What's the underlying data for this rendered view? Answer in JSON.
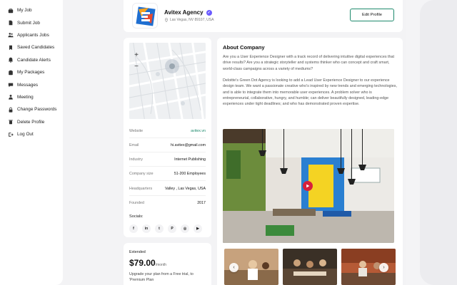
{
  "sidebar": {
    "items": [
      {
        "label": "My Job",
        "icon": "briefcase-icon"
      },
      {
        "label": "Submit Job",
        "icon": "document-icon"
      },
      {
        "label": "Applicants Jobs",
        "icon": "users-icon"
      },
      {
        "label": "Saved Candidates",
        "icon": "bookmark-icon"
      },
      {
        "label": "Candidate Alerts",
        "icon": "bell-icon"
      },
      {
        "label": "My Packages",
        "icon": "package-icon"
      },
      {
        "label": "Messages",
        "icon": "message-icon"
      },
      {
        "label": "Meeting",
        "icon": "meeting-icon"
      },
      {
        "label": "Change Passwords",
        "icon": "lock-icon"
      },
      {
        "label": "Delete Profile",
        "icon": "trash-icon"
      },
      {
        "label": "Log Out",
        "icon": "logout-icon"
      }
    ]
  },
  "header": {
    "company_name": "Avitex Agency",
    "verified_icon": "verified-check-icon",
    "location": "Las Vegas, NV 89107, USA",
    "edit_button": "Edit Profile"
  },
  "map": {
    "zoom_in": "+",
    "zoom_out": "−"
  },
  "info": {
    "rows": [
      {
        "key": "Website",
        "value": "avitex.vn"
      },
      {
        "key": "Email",
        "value": "hi.avitex@gmail.com"
      },
      {
        "key": "Industry",
        "value": "Internet Publishing"
      },
      {
        "key": "Company size",
        "value": "51-200 Employees"
      },
      {
        "key": "Headquarters",
        "value": "Valley , Las Vegas, USA"
      },
      {
        "key": "Founded",
        "value": "2017"
      }
    ],
    "socials_title": "Socials:",
    "socials": [
      {
        "icon": "facebook-icon",
        "glyph": "f"
      },
      {
        "icon": "linkedin-icon",
        "glyph": "in"
      },
      {
        "icon": "twitter-icon",
        "glyph": "t"
      },
      {
        "icon": "pinterest-icon",
        "glyph": "P"
      },
      {
        "icon": "instagram-icon",
        "glyph": "◎"
      },
      {
        "icon": "youtube-icon",
        "glyph": "▶"
      }
    ]
  },
  "plan": {
    "name": "Extended",
    "price": "$79.00",
    "period": "/month",
    "description": "Upgrade your plan from a Free trial, to 'Premium Plan"
  },
  "about": {
    "title": "About Company",
    "paragraph1": "Are you a User Experience Designer with a track record of delivering intuitive digital experiences that drive results? Are you a strategic storyteller and systems thinker who can concept and craft smart, world-class campaigns across a variety of mediums?",
    "paragraph2": "Deloitte's Green Dot Agency is looking to add a Lead User Experience Designer to our experience design team. We want a passionate creative who's inspired by new trends and emerging technologies, and is able to integrate them into memorable user experiences. A problem solver who is entrepreneurial, collaborative, hungry, and humble; can deliver beautifully designed, leading-edge experiences under tight deadlines; and who has demonstrated proven expertise."
  },
  "gallery": {
    "prev": "‹",
    "next": "›"
  },
  "colors": {
    "accent": "#1e8a6d",
    "verified": "#6b5bff",
    "play": "#d81f3b"
  }
}
